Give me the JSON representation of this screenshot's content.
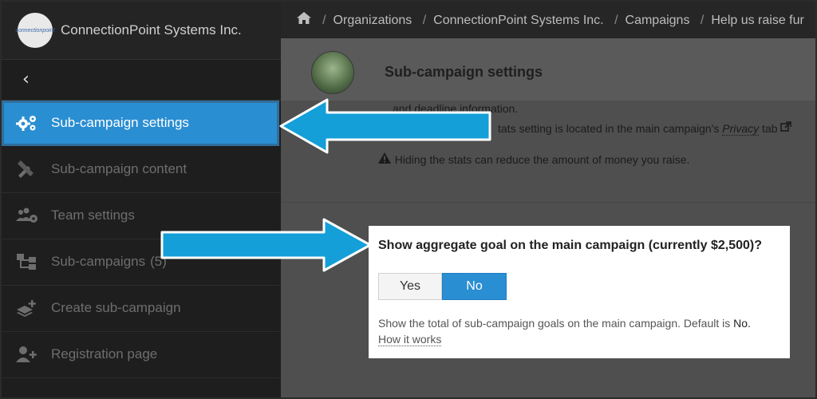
{
  "brand": {
    "logo_text": "connectionpoint",
    "name": "ConnectionPoint Systems Inc."
  },
  "sidebar": {
    "collapse_glyph": "‹",
    "items": [
      {
        "label": "Sub-campaign settings",
        "icon": "gears-icon",
        "active": true
      },
      {
        "label": "Sub-campaign content",
        "icon": "pencil-ruler-icon"
      },
      {
        "label": "Team settings",
        "icon": "users-gear-icon"
      },
      {
        "label": "Sub-campaigns",
        "icon": "sitemap-icon",
        "count": "(5)"
      },
      {
        "label": "Create sub-campaign",
        "icon": "layer-plus-icon"
      },
      {
        "label": "Registration page",
        "icon": "user-plus-icon"
      }
    ]
  },
  "breadcrumb": {
    "items": [
      "Organizations",
      "ConnectionPoint Systems Inc.",
      "Campaigns",
      "Help us raise fur"
    ]
  },
  "header": {
    "title": "Sub-campaign settings"
  },
  "background_text": {
    "line1": "and deadline information.",
    "line2_prefix": "tats setting is located in the main campaign's ",
    "line2_link": "Privacy",
    "line2_suffix": " tab",
    "warning": "Hiding the stats can reduce the amount of money you raise."
  },
  "panel": {
    "question": "Show aggregate goal on the main campaign (currently $2,500)?",
    "yes_label": "Yes",
    "no_label": "No",
    "selected": "No",
    "help_text": "Show the total of sub-campaign goals on the main campaign. Default is ",
    "default_value": "No.",
    "how_link": "How it works"
  },
  "colors": {
    "accent": "#2a8ed2",
    "arrow": "#149fd8",
    "sidebar_bg": "#1e1e1e"
  }
}
